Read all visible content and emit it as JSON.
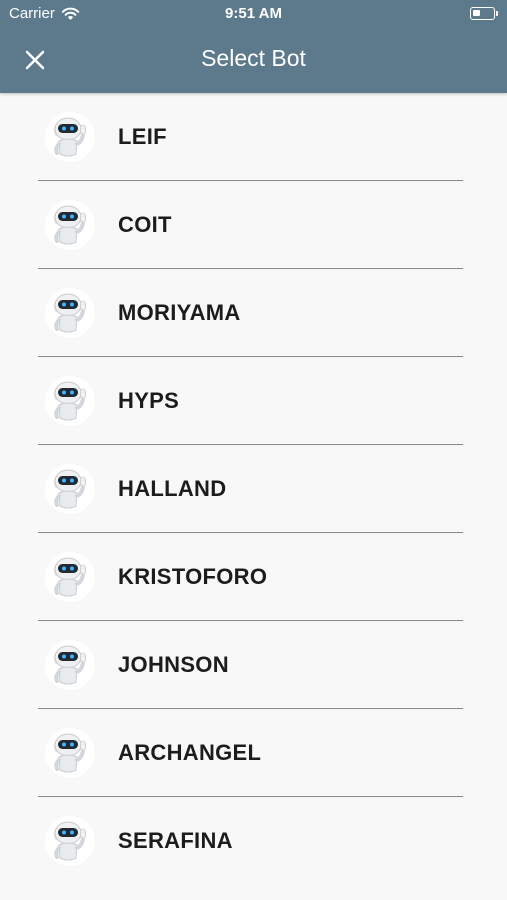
{
  "status_bar": {
    "carrier": "Carrier",
    "time": "9:51 AM"
  },
  "nav": {
    "title": "Select Bot",
    "close_icon": "close-icon"
  },
  "bots": [
    {
      "name": "LEIF",
      "icon": "robot-avatar-icon"
    },
    {
      "name": "COIT",
      "icon": "robot-avatar-icon"
    },
    {
      "name": "MORIYAMA",
      "icon": "robot-avatar-icon"
    },
    {
      "name": "HYPS",
      "icon": "robot-avatar-icon"
    },
    {
      "name": "HALLAND",
      "icon": "robot-avatar-icon"
    },
    {
      "name": "KRISTOFORO",
      "icon": "robot-avatar-icon"
    },
    {
      "name": "JOHNSON",
      "icon": "robot-avatar-icon"
    },
    {
      "name": "ARCHANGEL",
      "icon": "robot-avatar-icon"
    },
    {
      "name": "SERAFINA",
      "icon": "robot-avatar-icon"
    }
  ],
  "colors": {
    "header": "#5c7a8c",
    "background": "#f8f8f8",
    "text": "#1c1c1c",
    "divider": "#8a8a8a"
  }
}
